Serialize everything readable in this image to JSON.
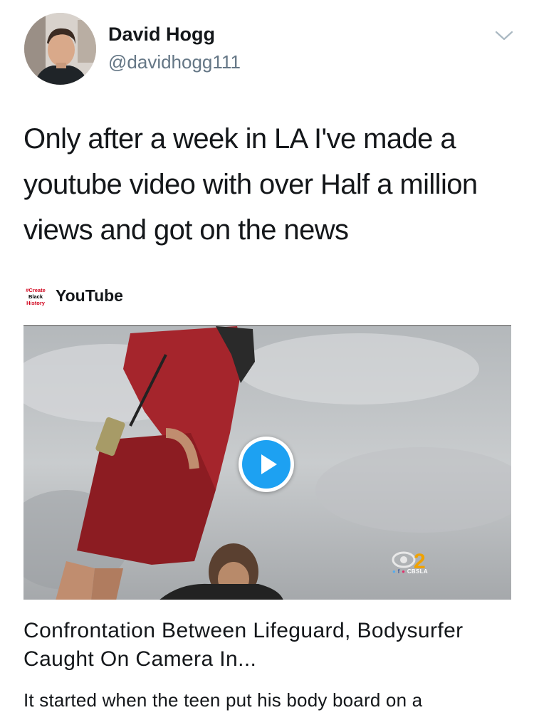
{
  "author": {
    "name": "David Hogg",
    "handle": "@davidhogg111"
  },
  "tweet": {
    "text": "Only after a week in LA I've made a youtube video with over Half a million views and got on the news"
  },
  "card": {
    "source_logo_text": "#Create Black History",
    "source": "YouTube",
    "channel_tag": "CBSLA",
    "title": "Confrontation Between Lifeguard, Bodysurfer Caught On Camera In...",
    "description": "It started when the teen put his body board on a"
  },
  "icons": {
    "menu": "chevron-down-icon",
    "play": "play-icon"
  },
  "colors": {
    "accent": "#1da1f2",
    "text": "#14171a",
    "secondary_text": "#657786"
  }
}
